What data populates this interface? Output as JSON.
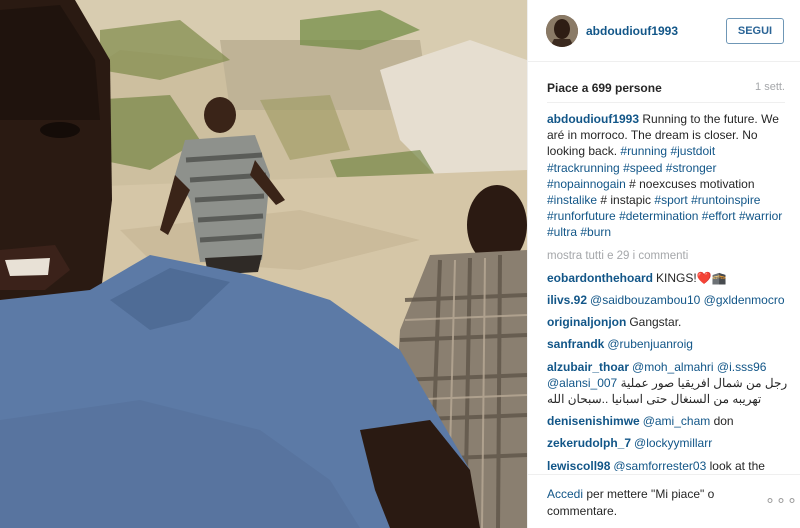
{
  "post": {
    "username": "abdoudiouf1993",
    "follow_label": "SEGUI",
    "likes": "Piace a 699 persone",
    "time_ago": "1 sett.",
    "caption_user": "abdoudiouf1993",
    "caption_text": " Running to the future. We aré in morroco. The dream is closer. No looking back. ",
    "caption_tags": [
      {
        "text": "#running",
        "kind": "tag"
      },
      {
        "text": " ",
        "kind": "plain"
      },
      {
        "text": "#justdoit",
        "kind": "tag"
      },
      {
        "text": " ",
        "kind": "plain"
      },
      {
        "text": "#trackrunning",
        "kind": "tag"
      },
      {
        "text": " ",
        "kind": "plain"
      },
      {
        "text": "#speed",
        "kind": "tag"
      },
      {
        "text": " ",
        "kind": "plain"
      },
      {
        "text": "#stronger",
        "kind": "tag"
      },
      {
        "text": " ",
        "kind": "plain"
      },
      {
        "text": "#nopainnogain",
        "kind": "tag"
      },
      {
        "text": " # noexcuses motivation ",
        "kind": "plain"
      },
      {
        "text": "#instalike",
        "kind": "tag"
      },
      {
        "text": " # instapic ",
        "kind": "plain"
      },
      {
        "text": "#sport",
        "kind": "tag"
      },
      {
        "text": " ",
        "kind": "plain"
      },
      {
        "text": "#runtoinspire",
        "kind": "tag"
      },
      {
        "text": " ",
        "kind": "plain"
      },
      {
        "text": "#runforfuture",
        "kind": "tag"
      },
      {
        "text": " ",
        "kind": "plain"
      },
      {
        "text": "#determination",
        "kind": "tag"
      },
      {
        "text": " ",
        "kind": "plain"
      },
      {
        "text": "#effort",
        "kind": "tag"
      },
      {
        "text": " ",
        "kind": "plain"
      },
      {
        "text": "#warrior",
        "kind": "tag"
      },
      {
        "text": " ",
        "kind": "plain"
      },
      {
        "text": "#ultra",
        "kind": "tag"
      },
      {
        "text": " ",
        "kind": "plain"
      },
      {
        "text": "#burn",
        "kind": "tag"
      }
    ],
    "show_all_comments": "mostra tutti e 29 i commenti"
  },
  "comments": [
    {
      "user": "eobardonthehoard",
      "parts": [
        {
          "text": "KINGS!❤️🕋",
          "kind": "plain"
        }
      ]
    },
    {
      "user": "ilivs.92",
      "parts": [
        {
          "text": "@saidbouzambou10",
          "kind": "tag"
        },
        {
          "text": " ",
          "kind": "plain"
        },
        {
          "text": "@gxldenmocro",
          "kind": "tag"
        }
      ]
    },
    {
      "user": "originaljonjon",
      "parts": [
        {
          "text": "Gangstar.",
          "kind": "plain"
        }
      ]
    },
    {
      "user": "sanfrandk",
      "parts": [
        {
          "text": "@rubenjuanroig",
          "kind": "tag"
        }
      ]
    },
    {
      "user": "alzubair_thoar",
      "parts": [
        {
          "text": "@moh_almahri",
          "kind": "tag"
        },
        {
          "text": " ",
          "kind": "plain"
        },
        {
          "text": "@i.sss96",
          "kind": "tag"
        },
        {
          "text": " ",
          "kind": "plain"
        },
        {
          "text": "@alansi_007",
          "kind": "tag"
        },
        {
          "text": " رجل من شمال افريقيا صور عملية تهريبه من السنغال حتى اسبانيا ..سبحان الله",
          "kind": "plain"
        }
      ]
    },
    {
      "user": "denisenishimwe",
      "parts": [
        {
          "text": "@ami_cham",
          "kind": "tag"
        },
        {
          "text": " don",
          "kind": "plain"
        }
      ]
    },
    {
      "user": "zekerudolph_7",
      "parts": [
        {
          "text": "@lockyymillarr",
          "kind": "tag"
        }
      ]
    },
    {
      "user": "lewiscoll98",
      "parts": [
        {
          "text": "@samforrester03",
          "kind": "tag"
        },
        {
          "text": " look at the account",
          "kind": "plain"
        }
      ]
    }
  ],
  "footer": {
    "login_link": "Accedi",
    "login_text": " per mettere \"Mi piace\" o commentare.",
    "more_label": "∘∘∘"
  },
  "icons": {
    "more": "more-options-icon"
  },
  "colors": {
    "link": "#125688",
    "follow_border": "#6f97b6",
    "muted": "#a5a7aa"
  }
}
